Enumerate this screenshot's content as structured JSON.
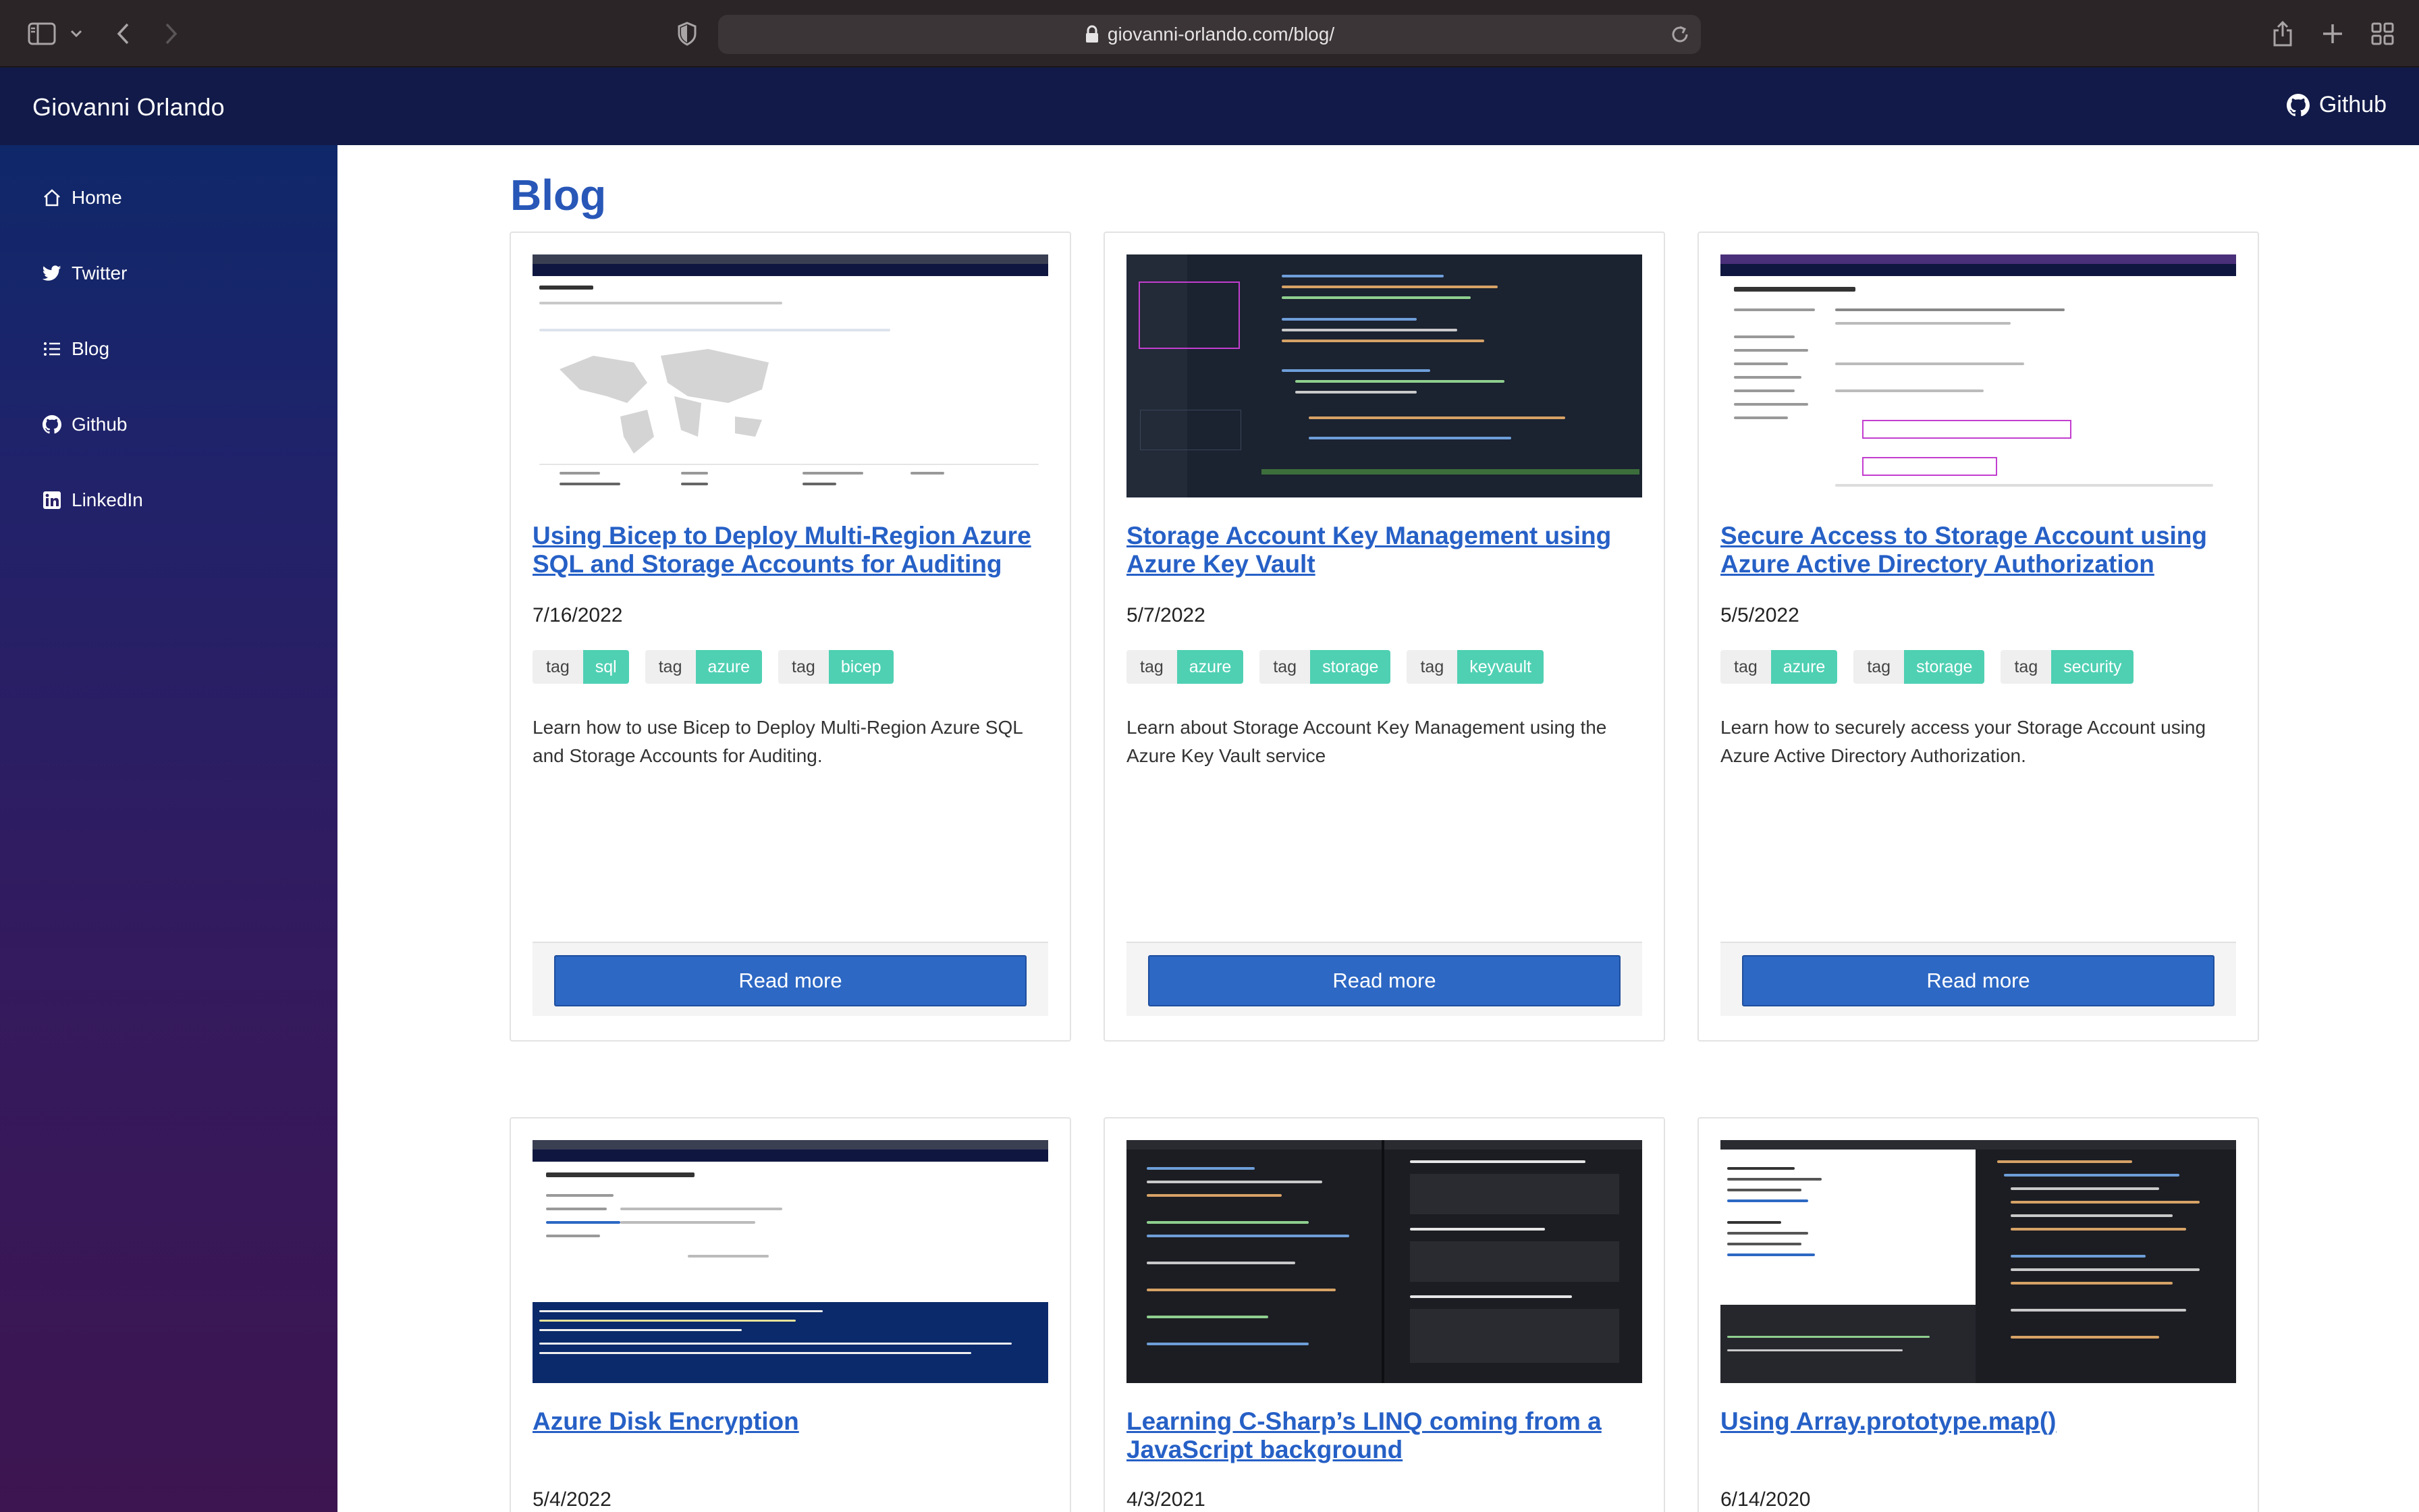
{
  "browser": {
    "url": "giovanni-orlando.com/blog/"
  },
  "app": {
    "title": "Giovanni Orlando",
    "github_label": "Github"
  },
  "sidebar": {
    "items": [
      {
        "label": "Home",
        "icon": "home-icon"
      },
      {
        "label": "Twitter",
        "icon": "twitter-icon"
      },
      {
        "label": "Blog",
        "icon": "list-icon"
      },
      {
        "label": "Github",
        "icon": "github-icon"
      },
      {
        "label": "LinkedIn",
        "icon": "linkedin-icon"
      }
    ]
  },
  "main": {
    "heading": "Blog",
    "tag_key": "tag",
    "read_more": "Read more",
    "posts": [
      {
        "title": "Using Bicep to Deploy Multi-Region Azure SQL and Storage Accounts for Auditing",
        "date": "7/16/2022",
        "tags": [
          "sql",
          "azure",
          "bicep"
        ],
        "description": "Learn how to use Bicep to Deploy Multi-Region Azure SQL and Storage Accounts for Auditing."
      },
      {
        "title": "Storage Account Key Management using Azure Key Vault",
        "date": "5/7/2022",
        "tags": [
          "azure",
          "storage",
          "keyvault"
        ],
        "description": "Learn about Storage Account Key Management using the Azure Key Vault service"
      },
      {
        "title": "Secure Access to Storage Account using Azure Active Directory Authorization",
        "date": "5/5/2022",
        "tags": [
          "azure",
          "storage",
          "security"
        ],
        "description": "Learn how to securely access your Storage Account using Azure Active Directory Authorization."
      },
      {
        "title": "Azure Disk Encryption",
        "date": "5/4/2022"
      },
      {
        "title": "Learning C-Sharp’s LINQ coming from a JavaScript background",
        "date": "4/3/2021"
      },
      {
        "title": "Using Array.prototype.map()",
        "date": "6/14/2020"
      }
    ]
  },
  "colors": {
    "topbar": "#111a48",
    "accent": "#2857b8",
    "link": "#2660c6",
    "tag": "#4fd0b3",
    "button": "#2d68c4"
  }
}
